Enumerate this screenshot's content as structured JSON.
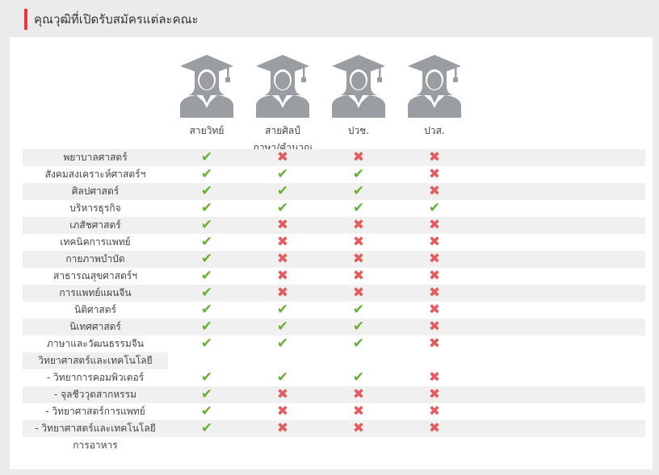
{
  "title": "คุณวุฒิที่เปิดรับสมัครแต่ละคณะ",
  "colors": {
    "accent": "#e8383d",
    "yes": "#66b032",
    "no": "#e35d5f",
    "avatar": "#9a9ea3"
  },
  "symbols": {
    "yes": "✔",
    "no": "✖"
  },
  "columns": [
    {
      "line1": "สายวิทย์",
      "line2": ""
    },
    {
      "line1": "สายศิลป์",
      "line2": "ภาษา/คำนวณ"
    },
    {
      "line1": "ปวช.",
      "line2": ""
    },
    {
      "line1": "ปวส.",
      "line2": ""
    }
  ],
  "rows": [
    {
      "label": "พยาบาลศาสตร์",
      "marks": [
        "yes",
        "no",
        "no",
        "no"
      ]
    },
    {
      "label": "สังคมสงเคราะห์ศาสตร์ฯ",
      "marks": [
        "yes",
        "yes",
        "yes",
        "no"
      ]
    },
    {
      "label": "ศิลปศาสตร์",
      "marks": [
        "yes",
        "yes",
        "yes",
        "no"
      ]
    },
    {
      "label": "บริหารธุรกิจ",
      "marks": [
        "yes",
        "yes",
        "yes",
        "yes"
      ]
    },
    {
      "label": "เภสัชศาสตร์",
      "marks": [
        "yes",
        "no",
        "no",
        "no"
      ]
    },
    {
      "label": "เทคนิคการแพทย์",
      "marks": [
        "yes",
        "no",
        "no",
        "no"
      ]
    },
    {
      "label": "กายภาพบำบัด",
      "marks": [
        "yes",
        "no",
        "no",
        "no"
      ]
    },
    {
      "label": "สาธารณสุขศาสตร์ฯ",
      "marks": [
        "yes",
        "no",
        "no",
        "no"
      ]
    },
    {
      "label": "การแพทย์แผนจีน",
      "marks": [
        "yes",
        "no",
        "no",
        "no"
      ]
    },
    {
      "label": "นิติศาสตร์",
      "marks": [
        "yes",
        "yes",
        "yes",
        "no"
      ]
    },
    {
      "label": "นิเทศศาสตร์",
      "marks": [
        "yes",
        "yes",
        "yes",
        "no"
      ]
    },
    {
      "label": "ภาษาและวัฒนธรรมจีน",
      "marks": [
        "yes",
        "yes",
        "yes",
        "no"
      ]
    },
    {
      "label": "วิทยาศาสตร์และเทคโนโลยี",
      "marks": []
    },
    {
      "label": "- วิทยาการคอมพิวเตอร์",
      "marks": [
        "yes",
        "yes",
        "yes",
        "no"
      ]
    },
    {
      "label": "- จุลชีววุตสากหรรม",
      "marks": [
        "yes",
        "no",
        "no",
        "no"
      ]
    },
    {
      "label": "- วิทยาศาสตร์การแพทย์",
      "marks": [
        "yes",
        "no",
        "no",
        "no"
      ]
    },
    {
      "label": "- วิทยาศาสตร์และเทคโนโลยี",
      "marks": [
        "yes",
        "no",
        "no",
        "no"
      ]
    },
    {
      "label": "การอาหาร",
      "marks": []
    }
  ]
}
